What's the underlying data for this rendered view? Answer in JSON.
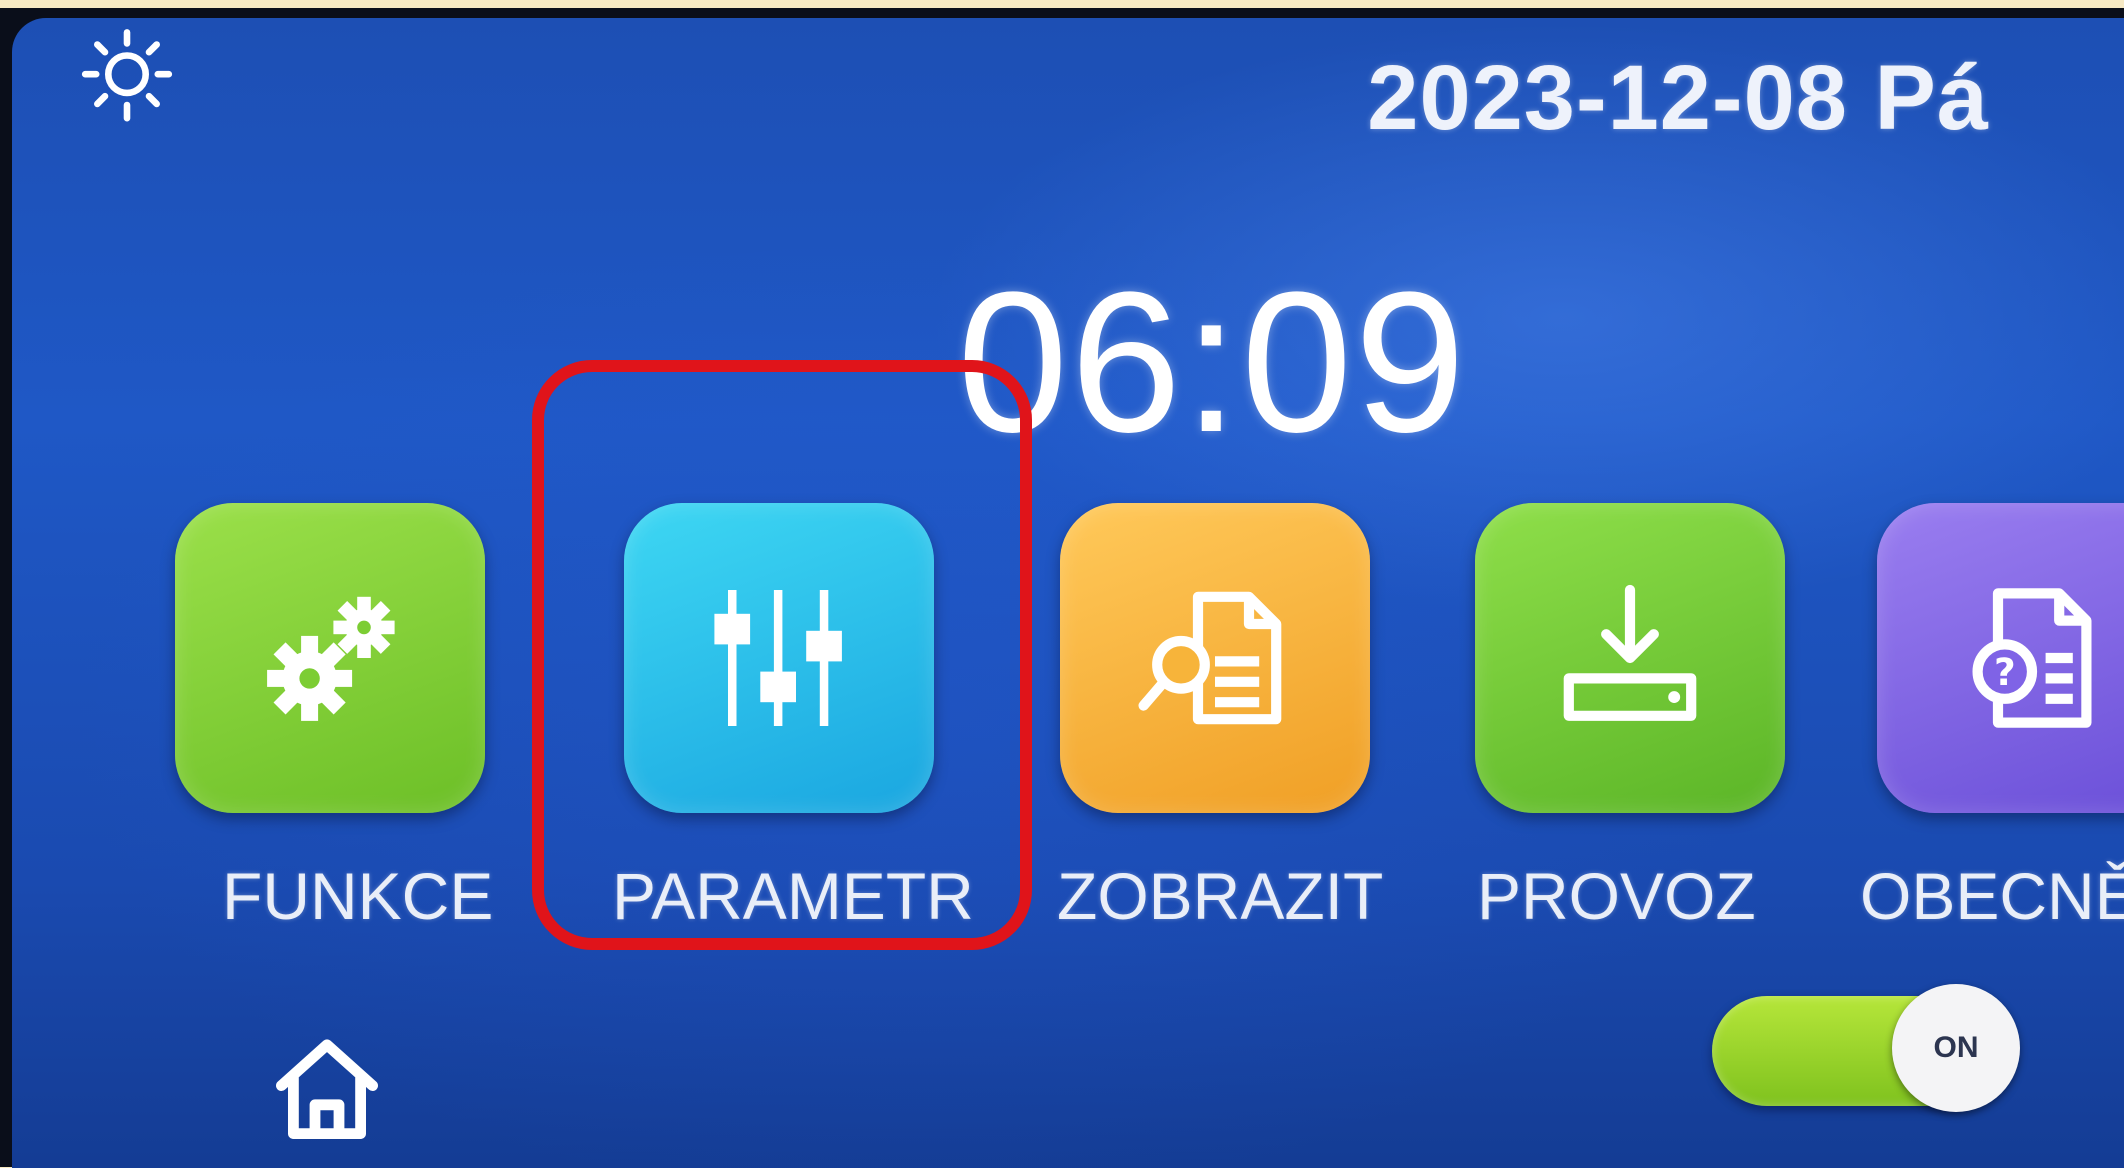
{
  "header": {
    "date": "2023-12-08 Pá",
    "time": "06:09",
    "brightness_icon": "sun-icon"
  },
  "menu": {
    "items": [
      {
        "label": "FUNKCE",
        "icon": "gears-icon",
        "color": "#7ccd33"
      },
      {
        "label": "PARAMETR",
        "icon": "sliders-icon",
        "color": "#26bdea",
        "highlighted": true
      },
      {
        "label": "ZOBRAZIT",
        "icon": "doc-search-icon",
        "color": "#f7b43a"
      },
      {
        "label": "PROVOZ",
        "icon": "download-tray-icon",
        "color": "#6fc430"
      },
      {
        "label": "OBECNĚ",
        "icon": "help-doc-icon",
        "color": "#7f63e6"
      }
    ]
  },
  "footer": {
    "home_icon": "home-icon",
    "power_toggle": {
      "label": "ON",
      "state": "on"
    }
  },
  "colors": {
    "background": "#1f58c6",
    "highlight": "#e0141a"
  }
}
